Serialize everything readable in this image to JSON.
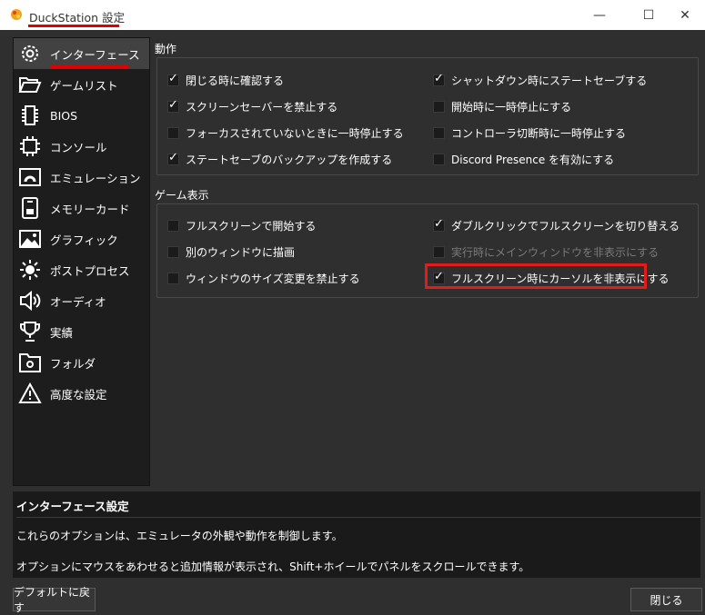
{
  "window": {
    "title": "DuckStation 設定",
    "controls": {
      "minimize": "—",
      "maximize": "☐",
      "close": "✕"
    }
  },
  "sidebar": {
    "items": [
      {
        "label": "インターフェース",
        "icon": "gear-icon"
      },
      {
        "label": "ゲームリスト",
        "icon": "folder-open-icon"
      },
      {
        "label": "BIOS",
        "icon": "chip-icon"
      },
      {
        "label": "コンソール",
        "icon": "cpu-icon"
      },
      {
        "label": "エミュレーション",
        "icon": "emulation-icon"
      },
      {
        "label": "メモリーカード",
        "icon": "memory-card-icon"
      },
      {
        "label": "グラフィック",
        "icon": "image-icon"
      },
      {
        "label": "ポストプロセス",
        "icon": "brightness-icon"
      },
      {
        "label": "オーディオ",
        "icon": "speaker-icon"
      },
      {
        "label": "実績",
        "icon": "trophy-icon"
      },
      {
        "label": "フォルダ",
        "icon": "folder-settings-icon"
      },
      {
        "label": "高度な設定",
        "icon": "warning-icon"
      }
    ]
  },
  "behavior": {
    "title": "動作",
    "options": [
      {
        "label": "閉じる時に確認する",
        "checked": true
      },
      {
        "label": "シャットダウン時にステートセーブする",
        "checked": true
      },
      {
        "label": "スクリーンセーバーを禁止する",
        "checked": true
      },
      {
        "label": "開始時に一時停止にする",
        "checked": false
      },
      {
        "label": "フォーカスされていないときに一時停止する",
        "checked": false
      },
      {
        "label": "コントローラ切断時に一時停止する",
        "checked": false
      },
      {
        "label": "ステートセーブのバックアップを作成する",
        "checked": true
      },
      {
        "label": "Discord Presence を有効にする",
        "checked": false
      }
    ]
  },
  "game_display": {
    "title": "ゲーム表示",
    "options": [
      {
        "label": "フルスクリーンで開始する",
        "checked": false
      },
      {
        "label": "ダブルクリックでフルスクリーンを切り替える",
        "checked": true
      },
      {
        "label": "別のウィンドウに描画",
        "checked": false
      },
      {
        "label": "実行時にメインウィンドウを非表示にする",
        "checked": false
      },
      {
        "label": "ウィンドウのサイズ変更を禁止する",
        "checked": false
      },
      {
        "label": "フルスクリーン時にカーソルを非表示にする",
        "checked": true
      }
    ]
  },
  "description": {
    "title": "インターフェース設定",
    "line1": "これらのオプションは、エミュレータの外観や動作を制御します。",
    "line2": "オプションにマウスをあわせると追加情報が表示され、Shift+ホイールでパネルをスクロールできます。"
  },
  "buttons": {
    "restore_defaults": "デフォルトに戻す",
    "close": "閉じる"
  },
  "colors": {
    "highlight": "#e21b1b",
    "underline": "#e00000"
  }
}
